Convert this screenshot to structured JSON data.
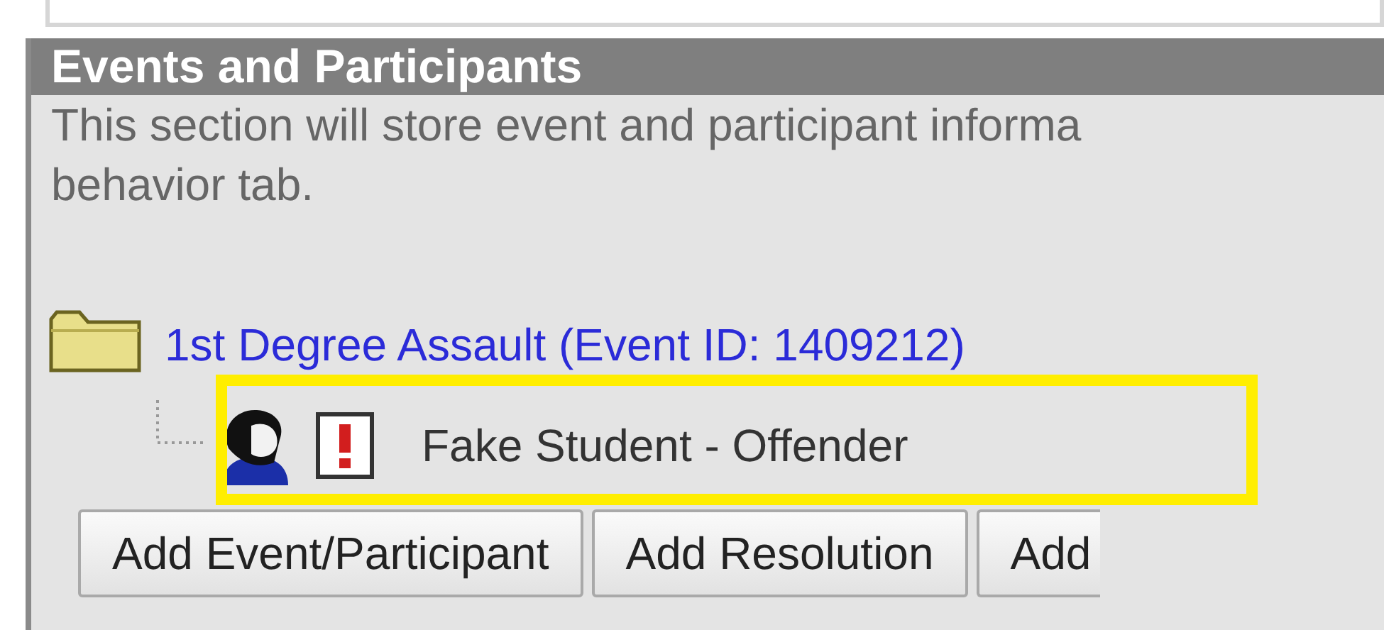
{
  "section": {
    "title": "Events and Participants",
    "description_lines": [
      "This section will store event and participant informa",
      "behavior tab."
    ]
  },
  "events": [
    {
      "label": "1st Degree Assault (Event ID: 1409212)",
      "expanded": true,
      "children": [
        {
          "label": "Fake Student - Offender",
          "kind": "student"
        }
      ]
    }
  ],
  "buttons": [
    "Add Event/Participant",
    "Add Resolution",
    "Add"
  ]
}
